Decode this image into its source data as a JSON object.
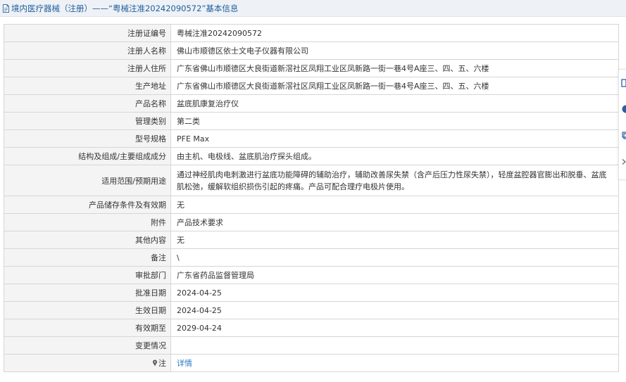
{
  "header": {
    "title": "境内医疗器械（注册）——“粤械注准20242090572”基本信息",
    "icon": "document-icon"
  },
  "rows": [
    {
      "label": "注册证编号",
      "value": "粤械注准20242090572"
    },
    {
      "label": "注册人名称",
      "value": "佛山市顺德区依士文电子仪器有限公司"
    },
    {
      "label": "注册人住所",
      "value": "广东省佛山市顺德区大良街道新滘社区凤翔工业区凤新路一街一巷4号A座三、四、五、六楼"
    },
    {
      "label": "生产地址",
      "value": "广东省佛山市顺德区大良街道新滘社区凤翔工业区凤新路一街一巷4号A座三、四、五、六楼"
    },
    {
      "label": "产品名称",
      "value": "盆底肌康复治疗仪"
    },
    {
      "label": "管理类别",
      "value": "第二类"
    },
    {
      "label": "型号规格",
      "value": "PFE Max"
    },
    {
      "label": "结构及组成/主要组成成分",
      "value": "由主机、电极线、盆底肌治疗探头组成。"
    },
    {
      "label": "适用范围/预期用途",
      "value": "通过神经肌肉电刺激进行盆底功能障碍的辅助治疗，辅助改善尿失禁（含产后压力性尿失禁），轻度盆腔器官膨出和脱垂、盆底肌松弛，缓解软组织损伤引起的疼痛。产品可配合理疗电极片使用。"
    },
    {
      "label": "产品储存条件及有效期",
      "value": "无"
    },
    {
      "label": "附件",
      "value": "产品技术要求"
    },
    {
      "label": "其他内容",
      "value": "无"
    },
    {
      "label": "备注",
      "value": "\\"
    },
    {
      "label": "审批部门",
      "value": "广东省药品监督管理局"
    },
    {
      "label": "批准日期",
      "value": "2024-04-25"
    },
    {
      "label": "生效日期",
      "value": "2024-04-25"
    },
    {
      "label": "有效期至",
      "value": "2029-04-24"
    },
    {
      "label": "变更情况",
      "value": ""
    }
  ],
  "note": {
    "label": "注",
    "link": "详情",
    "icon": "pin-icon"
  },
  "colors": {
    "header_bg": "#eef1f5",
    "title_text": "#1f5e9e",
    "label_bg": "#f4f4f4",
    "border": "#d6d6d6",
    "link": "#2b7bc8"
  }
}
